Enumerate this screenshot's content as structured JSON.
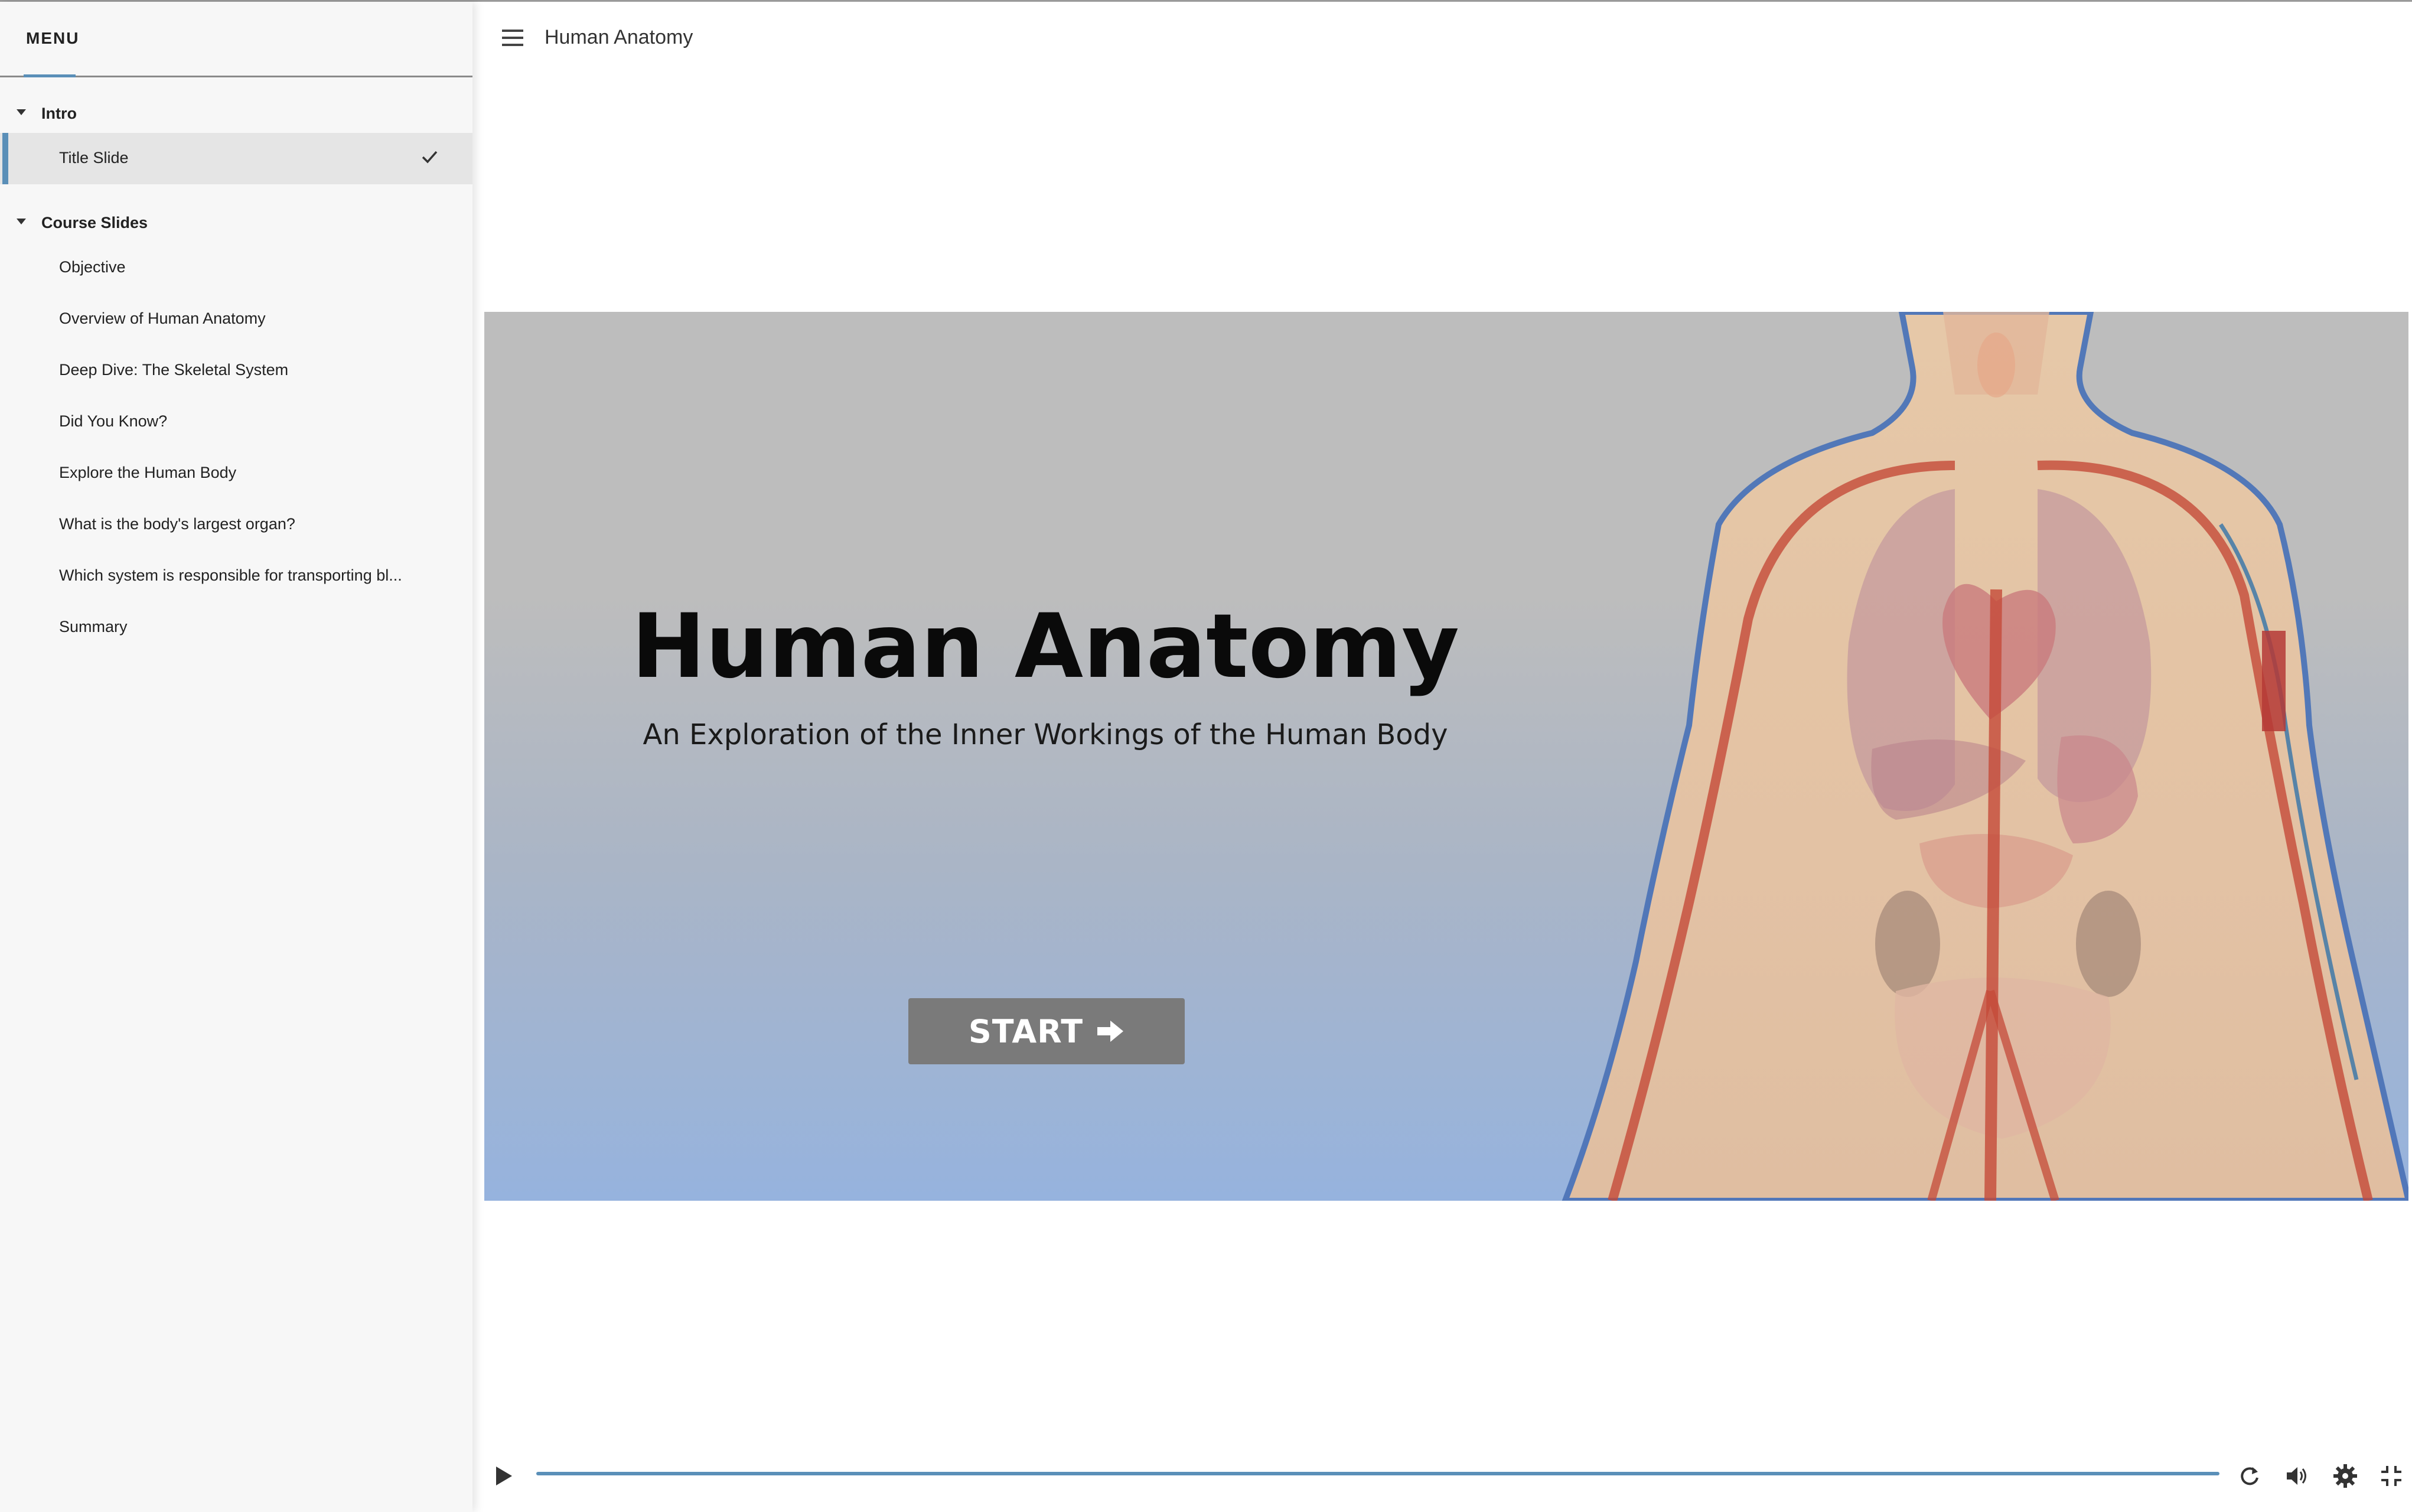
{
  "app": {
    "title": "Human Anatomy"
  },
  "sidebar": {
    "menu_label": "MENU",
    "sections": [
      {
        "title": "Intro",
        "items": [
          {
            "label": "Title Slide",
            "active": true,
            "completed": true
          }
        ]
      },
      {
        "title": "Course Slides",
        "items": [
          {
            "label": "Objective"
          },
          {
            "label": "Overview of Human Anatomy"
          },
          {
            "label": "Deep Dive: The Skeletal System"
          },
          {
            "label": "Did You Know?"
          },
          {
            "label": "Explore the Human Body"
          },
          {
            "label": "What is the body's largest organ?"
          },
          {
            "label": "Which system is responsible for transporting bl..."
          },
          {
            "label": "Summary"
          }
        ]
      }
    ]
  },
  "slide": {
    "title": "Human Anatomy",
    "subtitle": "An Exploration of the Inner Workings of the Human Body",
    "start_label": "START"
  },
  "player": {
    "progress": 1.0
  },
  "icons": {
    "menu": "hamburger-icon",
    "check": "checkmark-icon",
    "start": "arrow-right-icon",
    "play": "play-icon",
    "replay": "replay-icon",
    "volume": "volume-icon",
    "settings": "gear-icon",
    "fullscreen": "exit-fullscreen-icon"
  },
  "colors": {
    "accent": "#5a8fb8",
    "button": "#7a7a7a",
    "sidebar_bg": "#f7f7f7"
  }
}
